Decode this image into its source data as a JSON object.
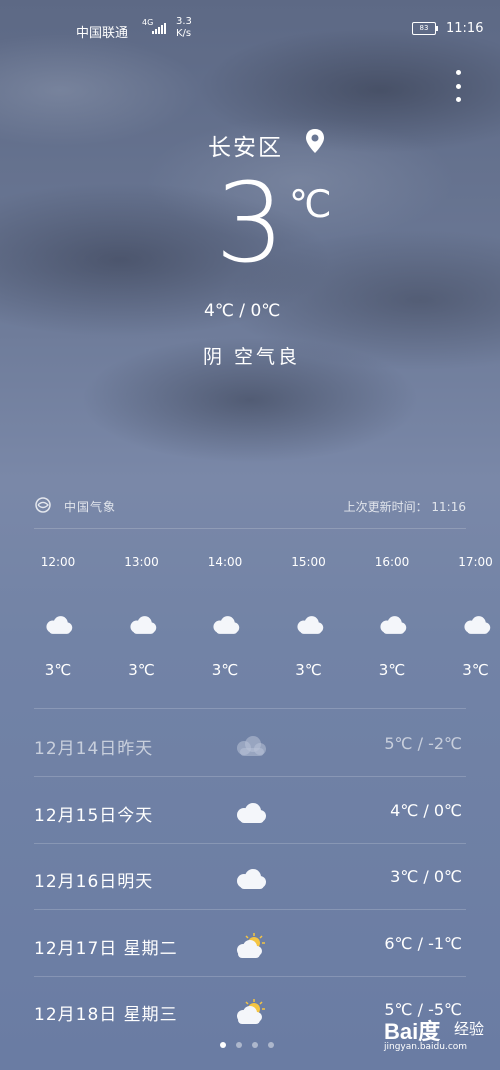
{
  "status": {
    "carrier": "中国联通",
    "network": "4G",
    "speed": "3.3\nK/s",
    "battery": "83",
    "time": "11:16"
  },
  "location": "长安区",
  "current": {
    "temp": "3",
    "unit": "℃",
    "range": "4℃ / 0℃",
    "condition": "阴  空气良"
  },
  "source": {
    "name": "中国气象",
    "updated": "上次更新时间： 11:16"
  },
  "hourly": [
    {
      "time": "12:00",
      "temp": "3℃",
      "icon": "cloud-icon"
    },
    {
      "time": "13:00",
      "temp": "3℃",
      "icon": "cloud-icon"
    },
    {
      "time": "14:00",
      "temp": "3℃",
      "icon": "cloud-icon"
    },
    {
      "time": "15:00",
      "temp": "3℃",
      "icon": "cloud-icon"
    },
    {
      "time": "16:00",
      "temp": "3℃",
      "icon": "cloud-icon"
    },
    {
      "time": "17:00",
      "temp": "3℃",
      "icon": "cloud-icon"
    }
  ],
  "daily": [
    {
      "date": "12月14日昨天",
      "range": "5℃ / -2℃",
      "icon": "cloud-icon"
    },
    {
      "date": "12月15日今天",
      "range": "4℃ / 0℃",
      "icon": "cloud-icon"
    },
    {
      "date": "12月16日明天",
      "range": "3℃ / 0℃",
      "icon": "cloud-icon"
    },
    {
      "date": "12月17日 星期二",
      "range": "6℃ / -1℃",
      "icon": "sun-cloud-icon"
    },
    {
      "date": "12月18日 星期三",
      "range": "5℃ / -5℃",
      "icon": "sun-cloud-icon"
    }
  ],
  "watermark": {
    "brand": "Bai度",
    "jingyan": "经验",
    "url": "jingyan.baidu.com"
  },
  "pager": {
    "count": 4,
    "active": 0
  }
}
